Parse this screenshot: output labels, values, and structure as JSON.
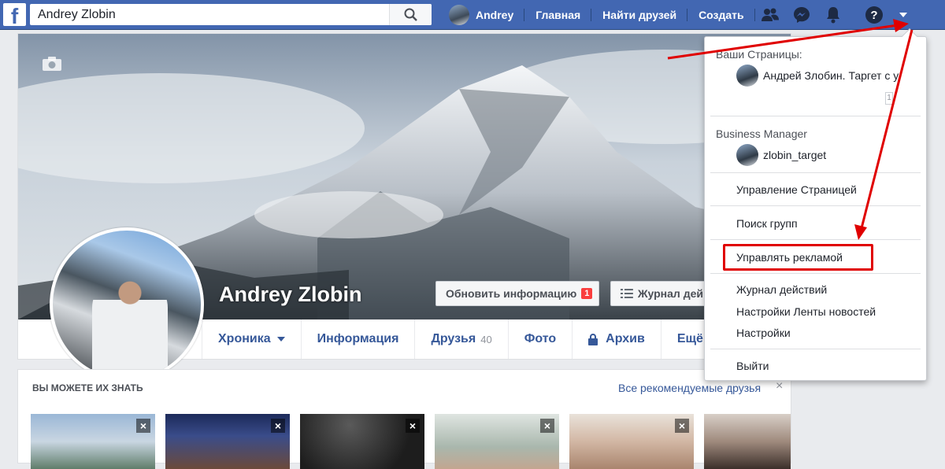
{
  "header": {
    "logo_letter": "f",
    "search_value": "Andrey Zlobin",
    "user_name": "Andrey",
    "nav_home": "Главная",
    "nav_find_friends": "Найти друзей",
    "nav_create": "Создать",
    "accent_color": "#4267b2"
  },
  "profile": {
    "name": "Andrey Zlobin",
    "update_info_label": "Обновить информацию",
    "update_info_badge": "1",
    "activity_log_label": "Журнал дей",
    "tabs": {
      "timeline": "Хроника",
      "about": "Информация",
      "friends": "Друзья",
      "friends_count": "40",
      "photos": "Фото",
      "archive": "Архив",
      "more": "Ещё"
    }
  },
  "pymk": {
    "title": "ВЫ МОЖЕТЕ ИХ ЗНАТЬ",
    "see_all": "Все рекомендуемые друзья",
    "close_glyph": "×"
  },
  "dropdown": {
    "pages_header": "Ваши Страницы:",
    "page_name": "Андрей Злобин. Таргет с у",
    "page_count": "1",
    "bm_header": "Business Manager",
    "bm_name": "zlobin_target",
    "manage_page": "Управление Страницей",
    "find_groups": "Поиск групп",
    "manage_ads": "Управлять рекламой",
    "activity_log": "Журнал действий",
    "news_feed_settings": "Настройки Ленты новостей",
    "settings": "Настройки",
    "logout": "Выйти"
  },
  "annotation_color": "#e00000"
}
